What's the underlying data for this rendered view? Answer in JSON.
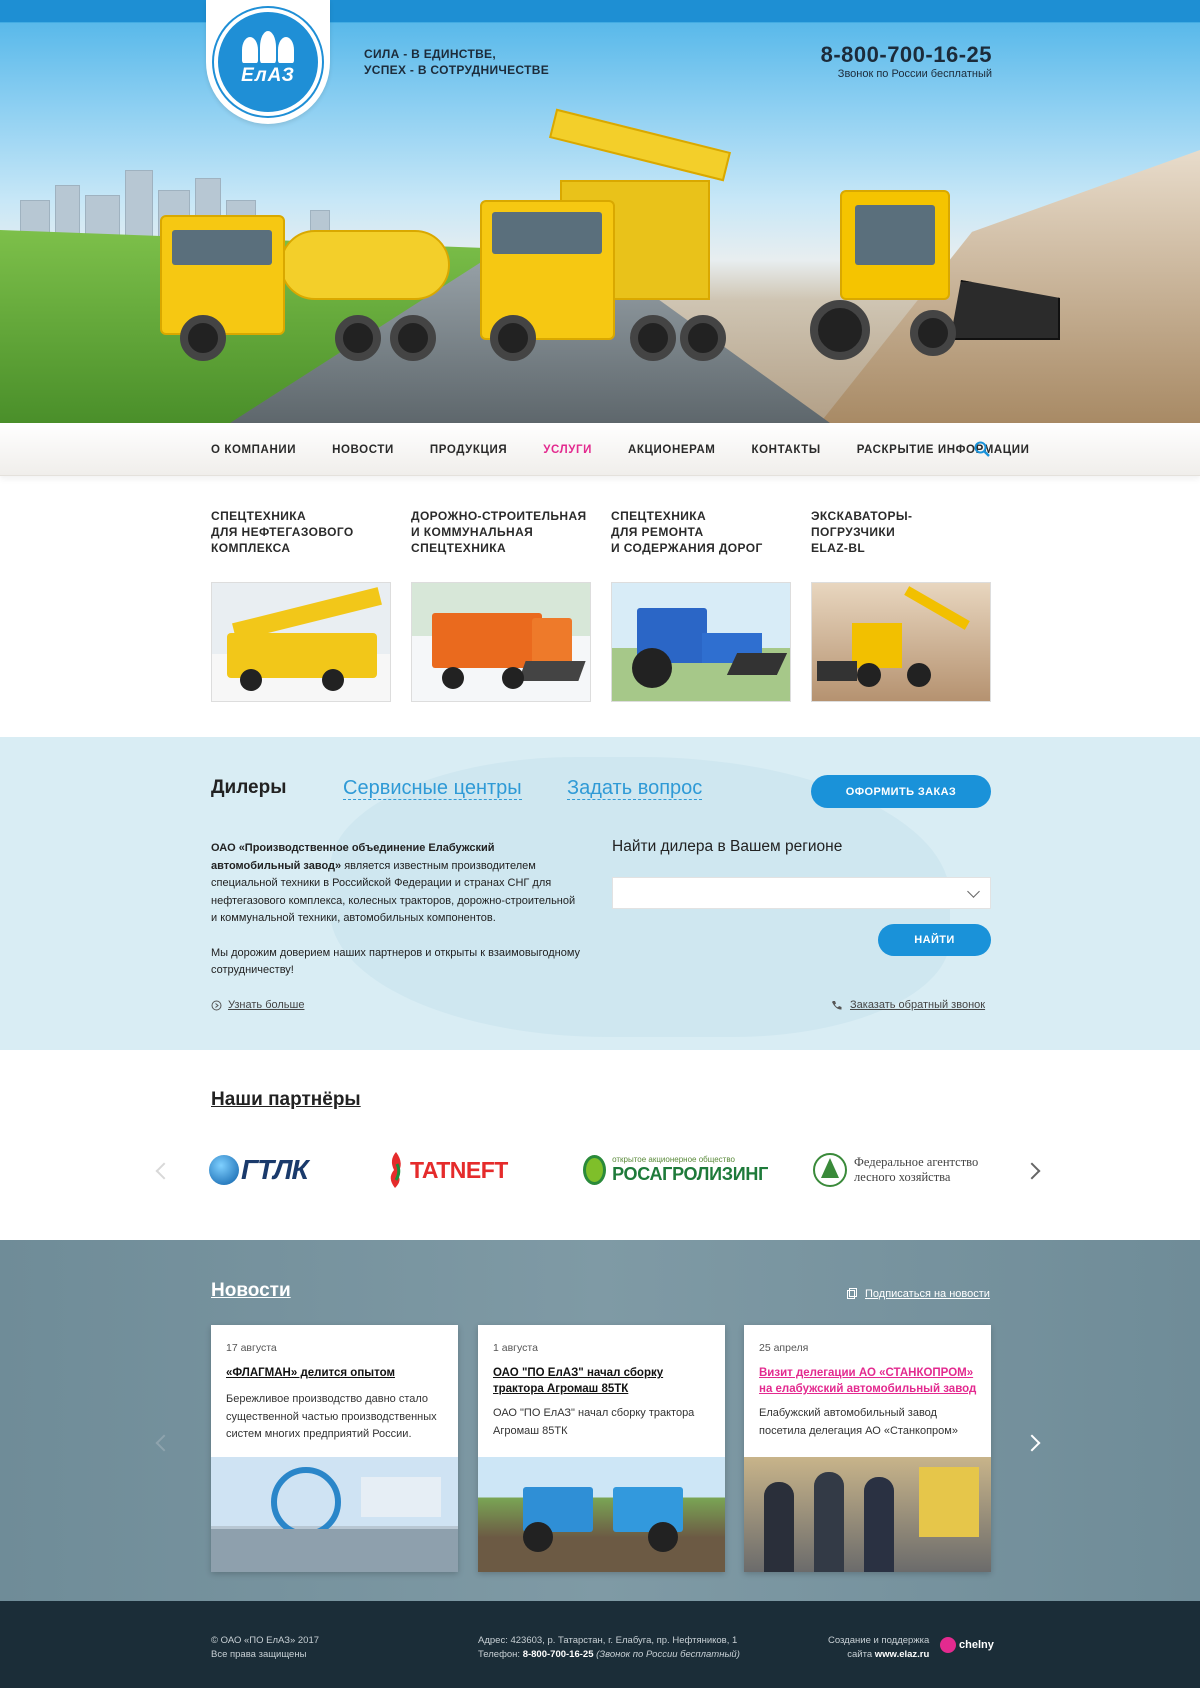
{
  "header": {
    "slogan_line1": "СИЛА - В ЕДИНСТВЕ,",
    "slogan_line2": "УСПЕХ - В СОТРУДНИЧЕСТВЕ",
    "phone": "8-800-700-16-25",
    "phone_note": "Звонок по России бесплатный",
    "logo_text": "ЕлАЗ"
  },
  "nav": {
    "items": [
      "О КОМПАНИИ",
      "НОВОСТИ",
      "ПРОДУКЦИЯ",
      "УСЛУГИ",
      "АКЦИОНЕРАМ",
      "КОНТАКТЫ",
      "РАСКРЫТИЕ ИНФОРМАЦИИ"
    ],
    "active": "УСЛУГИ"
  },
  "services": [
    {
      "line1": "СПЕЦТЕХНИКА",
      "line2": "ДЛЯ НЕФТЕГАЗОВОГО",
      "line3": "КОМПЛЕКСА"
    },
    {
      "line1": "ДОРОЖНО-СТРОИТЕЛЬНАЯ",
      "line2": "И КОММУНАЛЬНАЯ",
      "line3": "СПЕЦТЕХНИКА"
    },
    {
      "line1": "СПЕЦТЕХНИКА",
      "line2": "ДЛЯ РЕМОНТА",
      "line3": "И СОДЕРЖАНИЯ ДОРОГ"
    },
    {
      "line1": "ЭКСКАВАТОРЫ-ПОГРУЗЧИКИ",
      "line2": "ELAZ-BL",
      "line3": ""
    }
  ],
  "dealers": {
    "tab_active": "Дилеры",
    "tab_service": "Сервисные центры",
    "tab_question": "Задать вопрос",
    "order_button": "ОФОРМИТЬ ЗАКАЗ",
    "desc_bold": "ОАО «Производственное объединение Елабужский автомобильный завод»",
    "desc_rest": " является известным производителем специальной техники в Российской Федерации и странах СНГ для нефтегазового комплекса, колесных тракторов, дорожно-строительной и коммунальной техники, автомобильных компонентов.",
    "desc_2": "Мы дорожим доверием наших партнеров и открыты к взаимовыгодному сотрудничеству!",
    "more_link": "Узнать больше",
    "find_title": "Найти дилера в Вашем регионе",
    "select_value": "",
    "find_button": "НАЙТИ",
    "callback_link": "Заказать обратный звонок"
  },
  "partners": {
    "title": "Наши партнёры",
    "logos": [
      "ГТЛК",
      "TATNEFT",
      "РОСАГРОЛИЗИНГ",
      "Федеральное агентство лесного хозяйства"
    ],
    "rosagro_small": "открытое акционерное общество",
    "forest_line1": "Федеральное агентство",
    "forest_line2": "лесного хозяйства"
  },
  "news": {
    "title": "Новости",
    "subscribe": "Подписаться на новости",
    "items": [
      {
        "date": "17 августа",
        "title": "«ФЛАГМАН» делится опытом",
        "text": "Бережливое производство давно стало существенной частью производственных систем многих предприятий России."
      },
      {
        "date": "1 августа",
        "title": "ОАО \"ПО ЕлАЗ\" начал сборку трактора Агромаш 85ТК",
        "text": "ОАО \"ПО ЕлАЗ\" начал сборку трактора Агромаш 85ТК"
      },
      {
        "date": "25 апреля",
        "title": "Визит делегации АО «СТАНКОПРОМ» на елабужский автомобильный завод",
        "text": "Елабужский автомобильный завод посетила делегация АО «Станкопром»"
      }
    ]
  },
  "footer": {
    "copyright": "© ОАО «ПО ЕлАЗ» 2017",
    "rights": "Все права защищены",
    "address": "Адрес: 423603, р. Татарстан, г. Елабуга, пр. Нефтяников, 1",
    "phone_label": "Телефон: ",
    "phone": "8-800-700-16-25",
    "phone_note": " (Звонок по России бесплатный)",
    "created": "Создание и поддержка",
    "site_label": "сайта ",
    "site": "www.elaz.ru",
    "studio": "chelny"
  },
  "colors": {
    "brand": "#1a92d9",
    "active_nav": "#e32a8f",
    "footer_bg": "#1b2d38",
    "news_bg": "#778f9b"
  }
}
